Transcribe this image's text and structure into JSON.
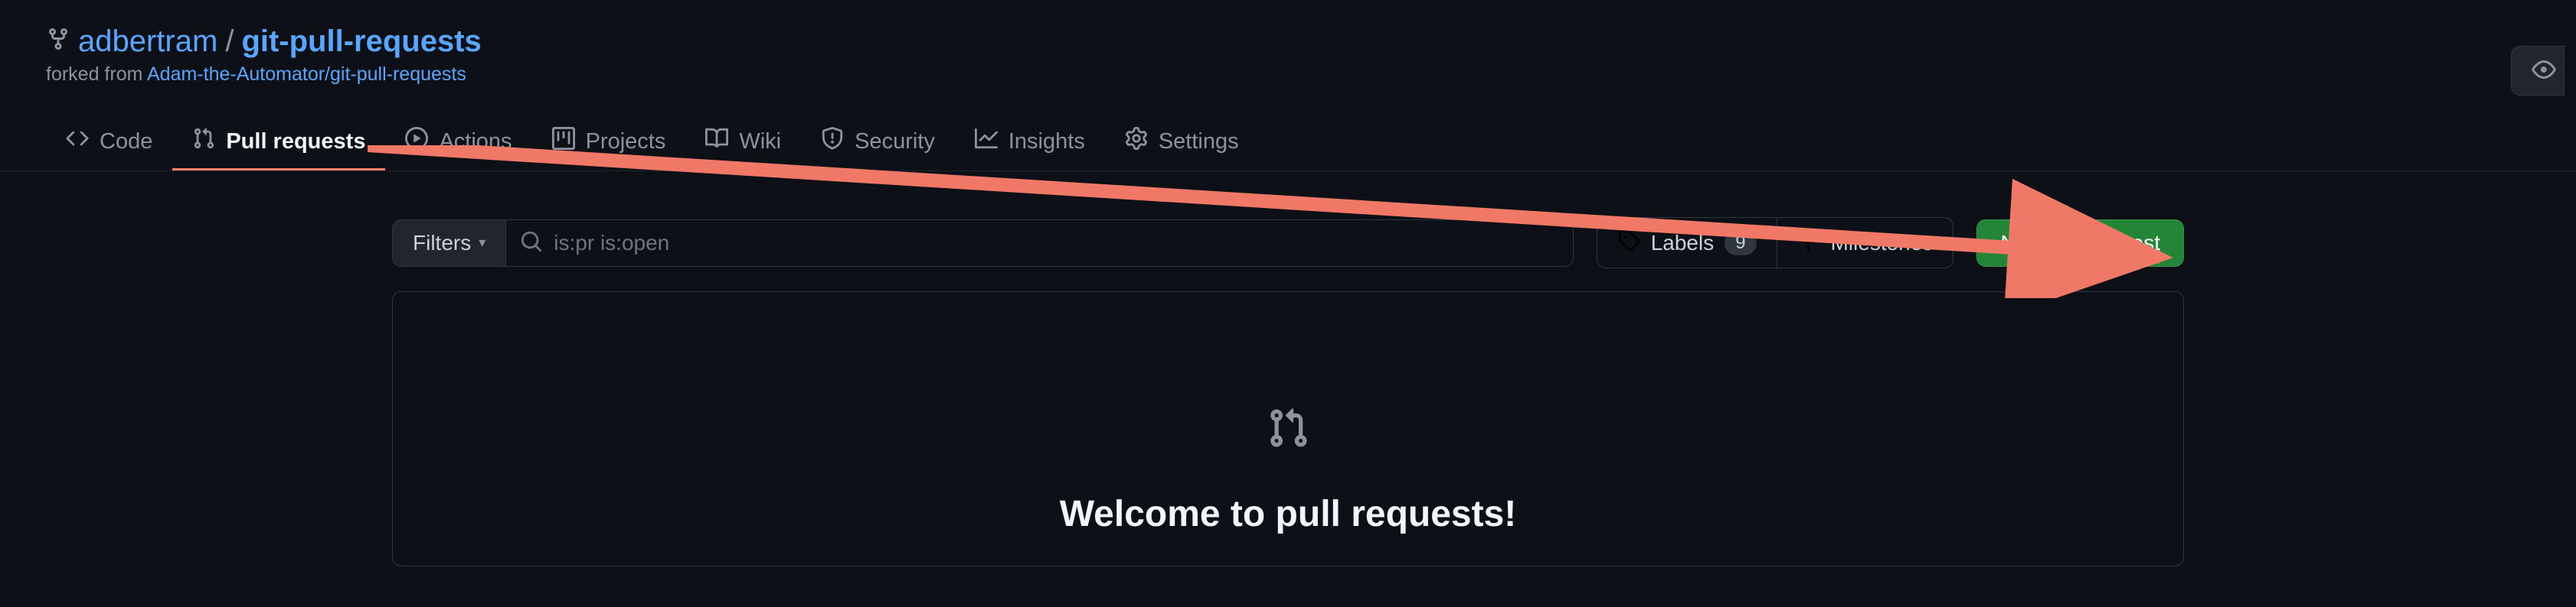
{
  "breadcrumb": {
    "owner": "adbertram",
    "separator": "/",
    "repo": "git-pull-requests"
  },
  "forked_from": {
    "prefix": "forked from ",
    "link": "Adam-the-Automator/git-pull-requests"
  },
  "tabs": [
    {
      "label": "Code",
      "icon": "code-icon",
      "active": false
    },
    {
      "label": "Pull requests",
      "icon": "git-pull-request-icon",
      "active": true
    },
    {
      "label": "Actions",
      "icon": "play-icon",
      "active": false
    },
    {
      "label": "Projects",
      "icon": "project-icon",
      "active": false
    },
    {
      "label": "Wiki",
      "icon": "book-icon",
      "active": false
    },
    {
      "label": "Security",
      "icon": "shield-icon",
      "active": false
    },
    {
      "label": "Insights",
      "icon": "graph-icon",
      "active": false
    },
    {
      "label": "Settings",
      "icon": "gear-icon",
      "active": false
    }
  ],
  "toolbar": {
    "filters_label": "Filters",
    "search_value": "is:pr is:open",
    "labels_label": "Labels",
    "labels_count": "9",
    "milestones_label": "Milestones",
    "new_pr_label": "New pull request"
  },
  "empty_state": {
    "title": "Welcome to pull requests!"
  },
  "colors": {
    "accent_orange": "#f78166",
    "link_blue": "#58a6ff",
    "green_button": "#238636",
    "bg": "#0d1117",
    "border": "#30363d"
  }
}
